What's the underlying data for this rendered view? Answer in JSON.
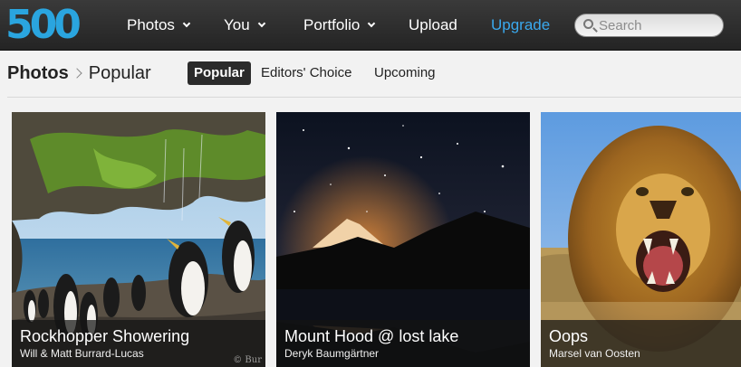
{
  "nav": {
    "logo": "500",
    "items": [
      {
        "label": "Photos",
        "dropdown": true
      },
      {
        "label": "You",
        "dropdown": true
      },
      {
        "label": "Portfolio",
        "dropdown": true
      },
      {
        "label": "Upload",
        "dropdown": false
      },
      {
        "label": "Upgrade",
        "dropdown": false
      }
    ],
    "search_placeholder": "Search"
  },
  "subheader": {
    "breadcrumb_root": "Photos",
    "breadcrumb_current": "Popular",
    "tabs": [
      {
        "label": "Popular",
        "active": true
      },
      {
        "label": "Editors' Choice",
        "active": false
      },
      {
        "label": "Upcoming",
        "active": false
      }
    ]
  },
  "photos": [
    {
      "title": "Rockhopper Showering",
      "author": "Will & Matt Burrard-Lucas",
      "watermark": "© Bur"
    },
    {
      "title": "Mount Hood @ lost lake",
      "author": "Deryk Baumgärtner"
    },
    {
      "title": "Oops",
      "author": "Marsel van Oosten"
    }
  ],
  "colors": {
    "brand": "#2aa5df",
    "upgrade": "#3aa9ee",
    "topbar": "#2e2e2e"
  }
}
